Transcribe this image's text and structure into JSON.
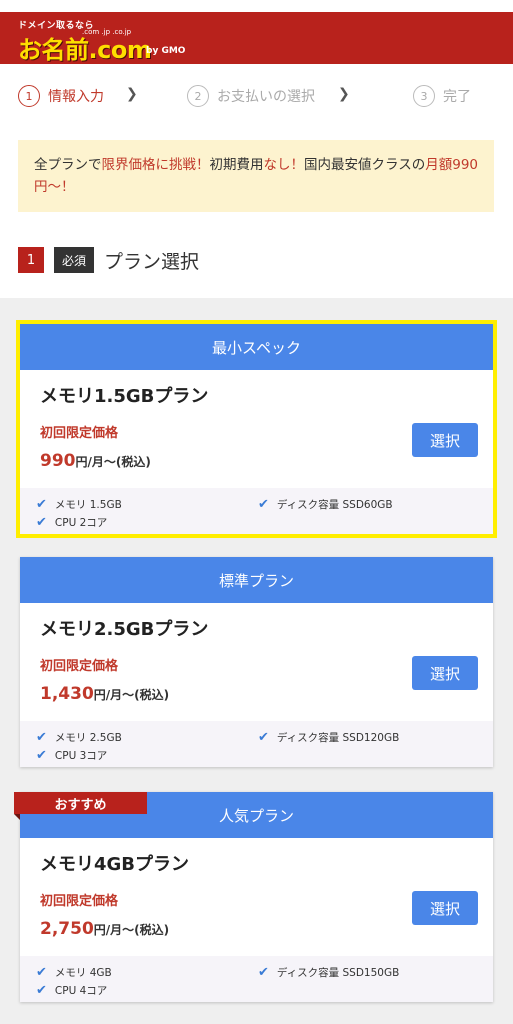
{
  "header": {
    "logo_tagline": "ドメイン取るなら",
    "logo_text": "お名前.com",
    "logo_domains": ".com .jp .co.jp",
    "logo_company": "by GMO"
  },
  "steps": [
    {
      "num": "1",
      "label": "情報入力",
      "active": true
    },
    {
      "num": "2",
      "label": "お支払いの選択",
      "active": false
    },
    {
      "num": "3",
      "label": "完了",
      "active": false
    }
  ],
  "notice": {
    "p1": "全プランで",
    "p2": "限界価格に挑戦！",
    "p3": "初期費用",
    "p4": "なし！",
    "p5": "国内最安値クラスの",
    "p6": "月額990円〜！"
  },
  "section": {
    "number": "1",
    "required": "必須",
    "title": "プラン選択"
  },
  "ribbon": "おすすめ",
  "plans": [
    {
      "header": "最小スペック",
      "name": "メモリ1.5GBプラン",
      "price_label": "初回限定価格",
      "price": "990",
      "price_suffix": "円/月〜(税込)",
      "button": "選択",
      "specs": {
        "memory": "メモリ 1.5GB",
        "disk": "ディスク容量 SSD60GB",
        "cpu": "CPU 2コア"
      }
    },
    {
      "header": "標準プラン",
      "name": "メモリ2.5GBプラン",
      "price_label": "初回限定価格",
      "price": "1,430",
      "price_suffix": "円/月〜(税込)",
      "button": "選択",
      "specs": {
        "memory": "メモリ 2.5GB",
        "disk": "ディスク容量 SSD120GB",
        "cpu": "CPU 3コア"
      }
    },
    {
      "header": "人気プラン",
      "name": "メモリ4GBプラン",
      "price_label": "初回限定価格",
      "price": "2,750",
      "price_suffix": "円/月〜(税込)",
      "button": "選択",
      "specs": {
        "memory": "メモリ 4GB",
        "disk": "ディスク容量 SSD150GB",
        "cpu": "CPU 4コア"
      }
    }
  ],
  "colors": {
    "brand_red": "#b8221c",
    "accent_blue": "#4a86e8",
    "highlight_yellow": "#ffee00"
  }
}
